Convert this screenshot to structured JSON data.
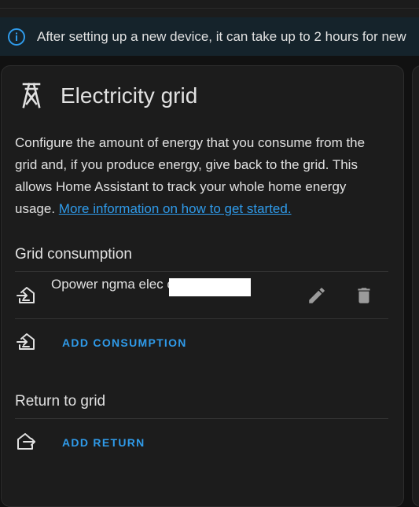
{
  "banner": {
    "icon": "info-icon",
    "text": "After setting up a new device, it can take up to 2 hours for new"
  },
  "card": {
    "icon": "transmission-tower-icon",
    "title": "Electricity grid",
    "description": "Configure the amount of energy that you consume from the grid and, if you produce energy, give back to the grid. This allows Home Assistant to track your whole home energy usage.",
    "link_text": "More information on how to get started."
  },
  "grid_consumption": {
    "title": "Grid consumption",
    "sources": [
      {
        "icon": "transmission-tower-import-icon",
        "name": "Opower ngma elec consumption",
        "actions": [
          "pencil-icon",
          "delete-icon"
        ]
      }
    ],
    "add_label": "ADD CONSUMPTION"
  },
  "return_to_grid": {
    "title": "Return to grid",
    "add_label": "ADD RETURN"
  },
  "colors": {
    "accent": "#2f9bea",
    "card_background": "#1c1c1c",
    "banner_background": "#15232b"
  }
}
